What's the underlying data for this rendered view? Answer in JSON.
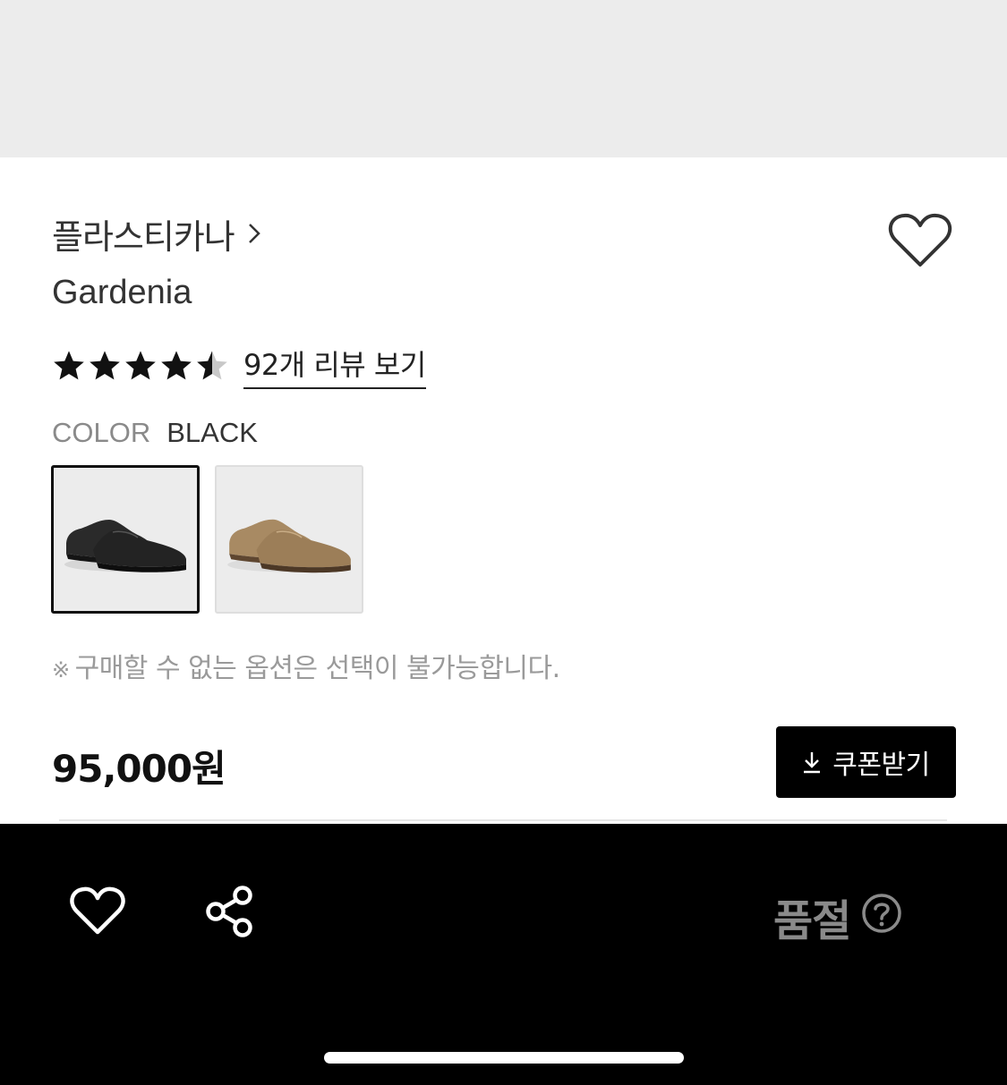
{
  "product": {
    "brand": "플라스티카나",
    "name": "Gardenia",
    "rating_value": 4.5,
    "rating_max": 5,
    "review_link": "92개 리뷰 보기",
    "color_label": "COLOR",
    "color_value": "BLACK",
    "options": [
      {
        "name": "black-shoe",
        "selected": true
      },
      {
        "name": "brown-shoe",
        "selected": false
      }
    ],
    "notice_mark": "※",
    "notice": "구매할 수 없는 옵션은 선택이 불가능합니다.",
    "price": "95,000원"
  },
  "coupon": {
    "label": "쿠폰받기",
    "icon": "download-icon"
  },
  "bottom_bar": {
    "wish_icon": "heart-icon",
    "share_icon": "share-icon",
    "status": "품절",
    "help_icon": "question-circle-icon"
  },
  "colors": {
    "image_bg": "#ececec",
    "bottom_bar": "#000000",
    "soldout_text": "#8a8a8a",
    "star": "#111111",
    "star_empty": "#c8c8c8"
  }
}
